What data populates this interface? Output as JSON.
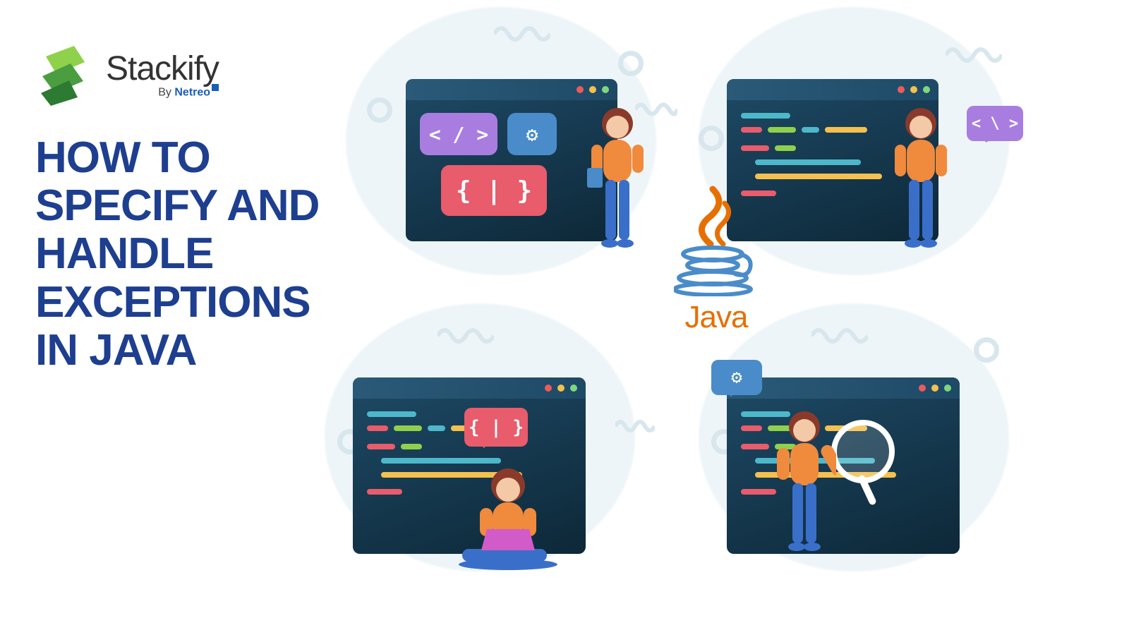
{
  "brand": {
    "name": "Stackify",
    "byline_prefix": "By ",
    "byline_company": "Netreo"
  },
  "title": "HOW TO SPECIFY AND HANDLE EXCEPTIONS IN JAVA",
  "java_label": "Java",
  "badges": {
    "code_tag": "< / >",
    "gear": "⚙",
    "braces": "{ | }",
    "code_tag_alt": "< \\ >"
  },
  "bubbles": {
    "p2": "< \\ >",
    "p3": "{ | }",
    "p4": "⚙"
  }
}
